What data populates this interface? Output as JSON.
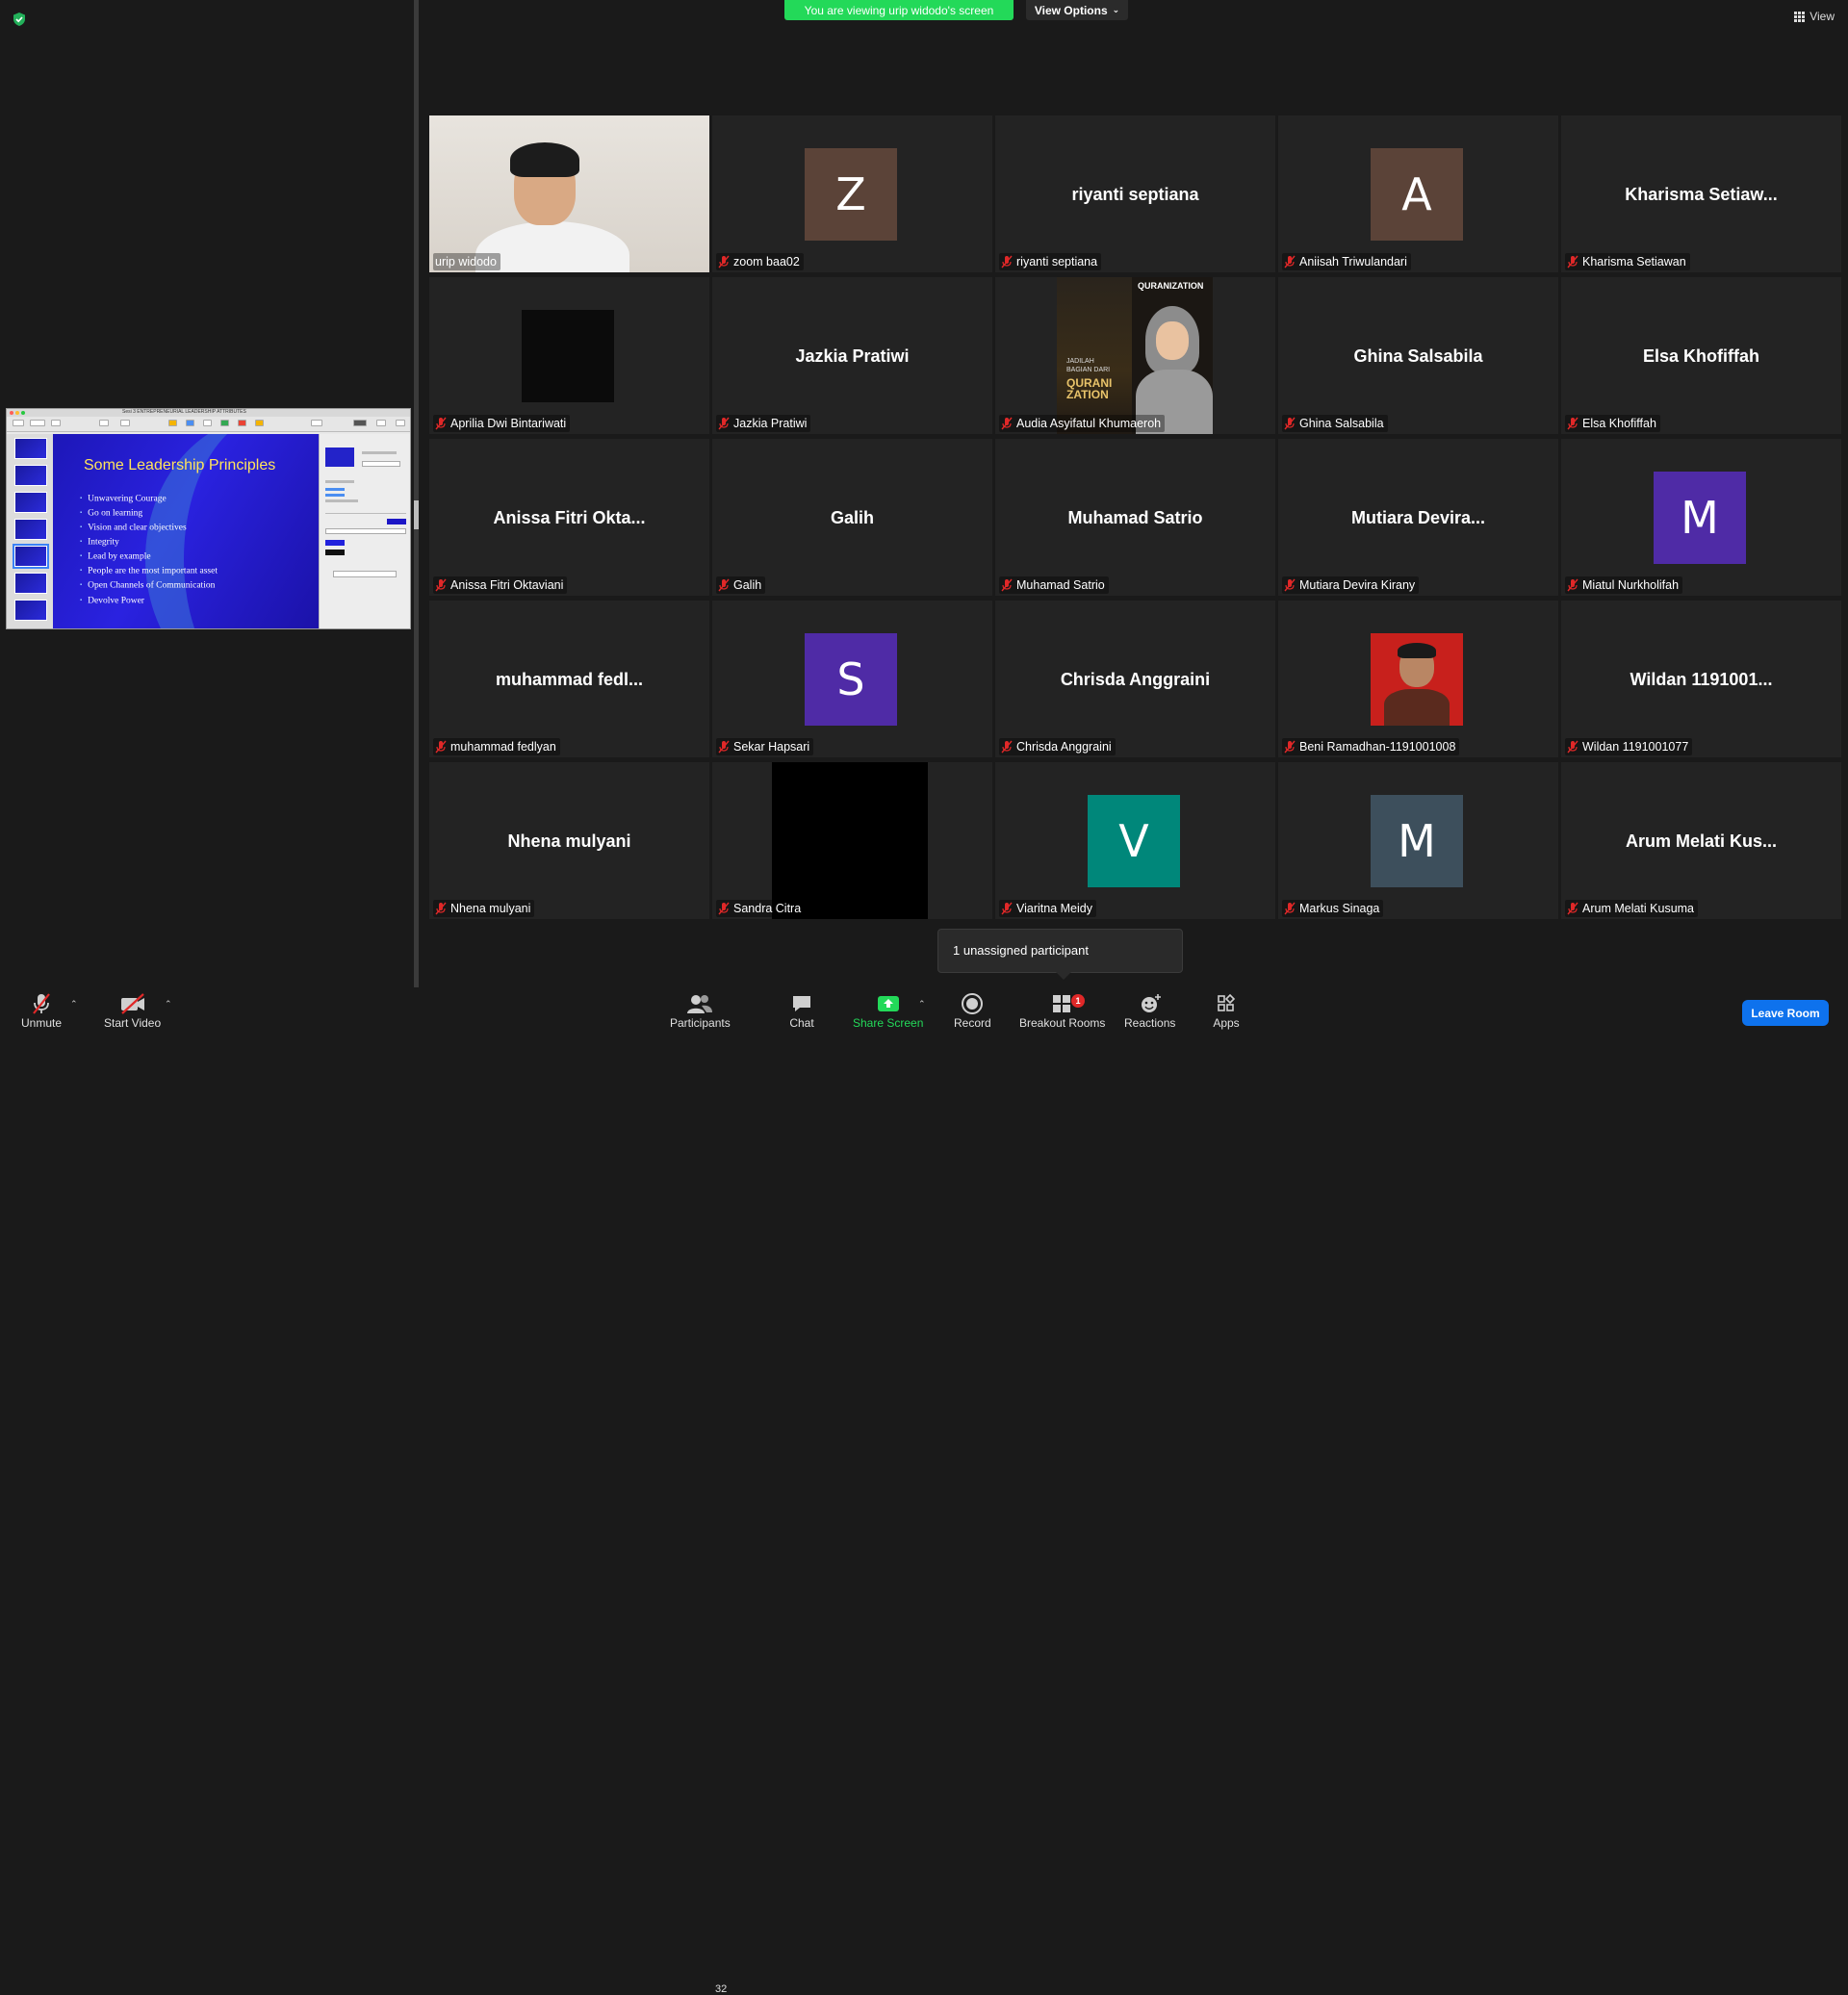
{
  "banner": {
    "viewing_text": "You are viewing urip widodo's screen",
    "view_options_label": "View Options"
  },
  "view_button_label": "View",
  "slide": {
    "app_title": "Sesi 3 ENTREPRENEURIAL LEADERSHIP ATTRIBUTES",
    "title": "Some Leadership Principles",
    "bullets": [
      "Unwavering Courage",
      "Go on learning",
      "Vision and clear objectives",
      "Integrity",
      "Lead by example",
      "People are the most important asset",
      "Open Channels of Communication",
      "Devolve Power"
    ]
  },
  "tiles": [
    {
      "label": "urip widodo",
      "type": "video",
      "muted": false,
      "active": true
    },
    {
      "label": "zoom baa02",
      "type": "avatar",
      "initial": "Z",
      "color": "#5b4338"
    },
    {
      "label": "riyanti septiana",
      "type": "name",
      "big": "riyanti septiana"
    },
    {
      "label": "Aniisah Triwulandari",
      "type": "avatar",
      "initial": "A",
      "color": "#5b4338"
    },
    {
      "label": "Kharisma Setiawan",
      "type": "name",
      "big": "Kharisma Setiaw..."
    },
    {
      "label": "Aprilia Dwi Bintariwati",
      "type": "black"
    },
    {
      "label": "Jazkia Pratiwi",
      "type": "name",
      "big": "Jazkia Pratiwi"
    },
    {
      "label": "Audia Asyifatul Khumaeroh",
      "type": "photo-quran"
    },
    {
      "label": "Ghina Salsabila",
      "type": "name",
      "big": "Ghina Salsabila"
    },
    {
      "label": "Elsa Khofiffah",
      "type": "name",
      "big": "Elsa Khofiffah"
    },
    {
      "label": "Anissa Fitri Oktaviani",
      "type": "name",
      "big": "Anissa Fitri Okta..."
    },
    {
      "label": "Galih",
      "type": "name",
      "big": "Galih"
    },
    {
      "label": "Muhamad Satrio",
      "type": "name",
      "big": "Muhamad Satrio"
    },
    {
      "label": "Mutiara Devira Kirany",
      "type": "name",
      "big": "Mutiara Devira..."
    },
    {
      "label": "Miatul Nurkholifah",
      "type": "avatar",
      "initial": "M",
      "color": "#4f2ba6"
    },
    {
      "label": "muhammad fedlyan",
      "type": "name",
      "big": "muhammad fedl..."
    },
    {
      "label": "Sekar Hapsari",
      "type": "avatar",
      "initial": "S",
      "color": "#4f2ba6"
    },
    {
      "label": "Chrisda Anggraini",
      "type": "name",
      "big": "Chrisda Anggraini"
    },
    {
      "label": "Beni Ramadhan-1191001008",
      "type": "photo-red"
    },
    {
      "label": "Wildan 1191001077",
      "type": "name",
      "big": "Wildan 1191001..."
    },
    {
      "label": "Nhena mulyani",
      "type": "name",
      "big": "Nhena mulyani"
    },
    {
      "label": "Sandra Citra",
      "type": "black-tall"
    },
    {
      "label": "Viaritna Meidy",
      "type": "avatar",
      "initial": "V",
      "color": "#00877a"
    },
    {
      "label": "Markus Sinaga",
      "type": "avatar",
      "initial": "M",
      "color": "#3d4f5c"
    },
    {
      "label": "Arum Melati Kusuma",
      "type": "name",
      "big": "Arum Melati Kus..."
    }
  ],
  "quran_text": {
    "brand": "QURANIZATION",
    "line1": "JADILAH",
    "line2": "BAGIAN DARI",
    "line3": "QURANI ZATION"
  },
  "tooltip": "1 unassigned participant",
  "toolbar": {
    "unmute": "Unmute",
    "start_video": "Start Video",
    "participants": "Participants",
    "participants_count": "32",
    "chat": "Chat",
    "share_screen": "Share Screen",
    "record": "Record",
    "breakout_rooms": "Breakout Rooms",
    "breakout_badge": "1",
    "reactions": "Reactions",
    "apps": "Apps",
    "leave": "Leave Room"
  },
  "colors": {
    "share_green": "#23d959",
    "leave_blue": "#0e72ed",
    "active_border": "#c8e86a",
    "mute_red": "#e02828"
  }
}
